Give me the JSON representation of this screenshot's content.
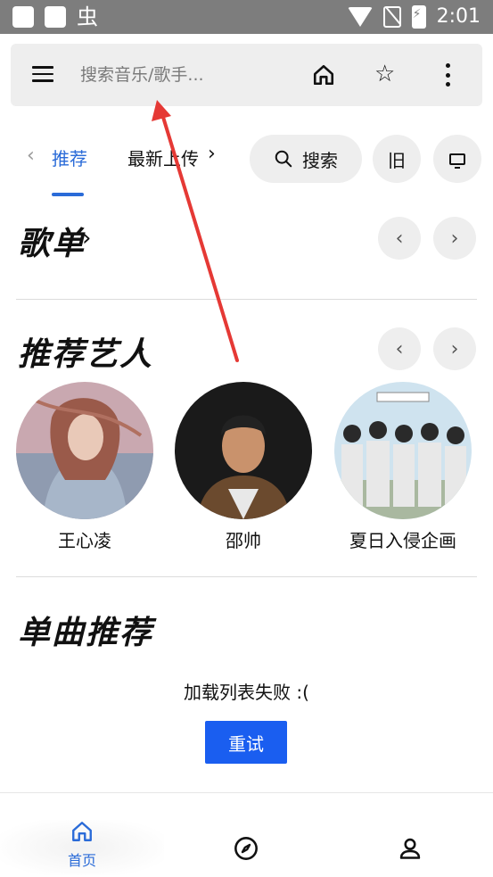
{
  "status_bar": {
    "left_char": "虫",
    "time": "2:01"
  },
  "search": {
    "placeholder": "搜索音乐/歌手..."
  },
  "tabs": {
    "active": "推荐",
    "active_visible": "推荐",
    "second": "最新上传"
  },
  "actions": {
    "search_label": "搜索",
    "old_label": "旧"
  },
  "sections": {
    "playlists_title": "歌单",
    "artists_title": "推荐艺人",
    "songs_title": "单曲推荐"
  },
  "artists": [
    {
      "name": "王心凌"
    },
    {
      "name": "邵帅"
    },
    {
      "name": "夏日入侵企画"
    }
  ],
  "songs": {
    "error_text": "加载列表失败 :(",
    "retry_label": "重试"
  },
  "bottom_nav": {
    "home_label": "首页"
  },
  "colors": {
    "accent": "#2a6bd8",
    "retry": "#1a5ef0",
    "annotation": "#e53935"
  }
}
